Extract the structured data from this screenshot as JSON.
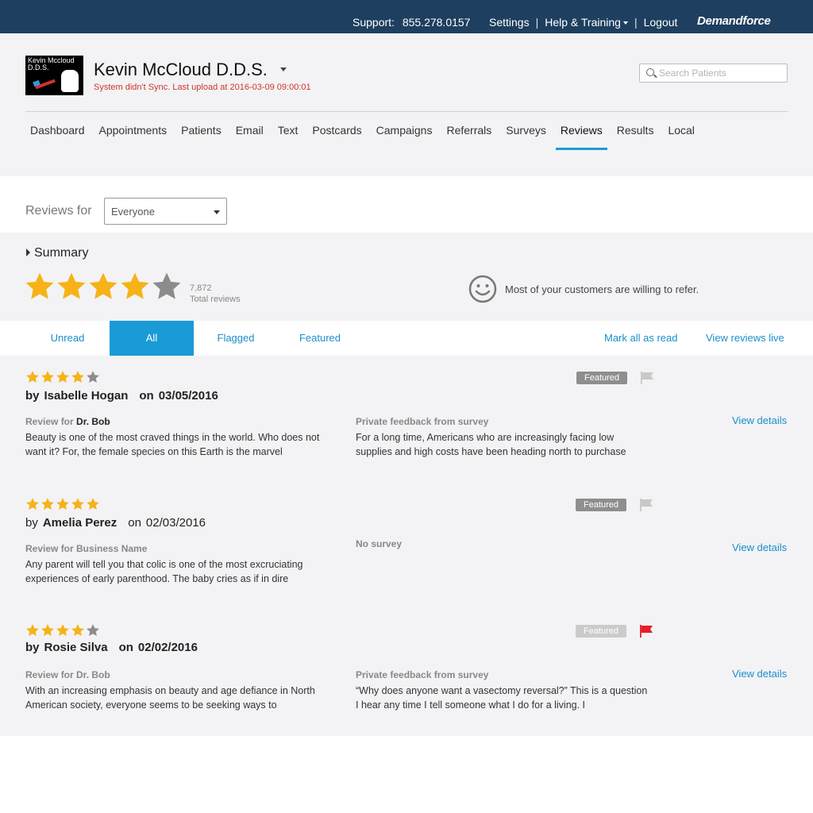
{
  "topbar": {
    "support_label": "Support:",
    "support_phone": "855.278.0157",
    "settings": "Settings",
    "separator": "|",
    "help": "Help & Training",
    "logout": "Logout",
    "brand": "Demandforce"
  },
  "header": {
    "logo_text": "Kevin Mccloud D.D.S.",
    "practice_name": "Kevin McCloud D.D.S.",
    "sync_status": "System didn't Sync. Last upload at 2016-03-09 09:00:01",
    "search_placeholder": "Search Patients"
  },
  "nav": [
    {
      "label": "Dashboard"
    },
    {
      "label": "Appointments"
    },
    {
      "label": "Patients"
    },
    {
      "label": "Email"
    },
    {
      "label": "Text"
    },
    {
      "label": "Postcards"
    },
    {
      "label": "Campaigns"
    },
    {
      "label": "Referrals"
    },
    {
      "label": "Surveys"
    },
    {
      "label": "Reviews",
      "active": true
    },
    {
      "label": "Results"
    },
    {
      "label": "Local"
    }
  ],
  "filter": {
    "label": "Reviews for",
    "selected": "Everyone"
  },
  "summary": {
    "title": "Summary",
    "rating": 4,
    "max_rating": 5,
    "total_count": "7,872",
    "total_label": "Total reviews",
    "refer_text": "Most of your customers are willing to refer."
  },
  "tabs": {
    "unread": "Unread",
    "all": "All",
    "flagged": "Flagged",
    "featured": "Featured",
    "mark_all_read": "Mark all as read",
    "view_live": "View reviews live"
  },
  "colors": {
    "topbar": "#1e3f5f",
    "accent": "#1a9ad6",
    "star_gold": "#f5b318",
    "star_gray": "#8c8c8c",
    "flag_red": "#e41f26"
  },
  "reviews": [
    {
      "rating": 4,
      "by": "by",
      "name": "Isabelle Hogan",
      "on": "on",
      "date": "03/05/2016",
      "bold_meta": true,
      "badge": "Featured",
      "badge_style": "dark",
      "flagged": false,
      "review_for_label": "Review for",
      "review_for_name": "Dr. Bob",
      "review_text": "Beauty is one of the most craved things in the world. Who does not want it? For, the female species on this Earth is the marvel",
      "private_label": "Private feedback from survey",
      "private_text": "For a long time, Americans who are increasingly facing low supplies and high costs have been heading north to purchase",
      "details": "View details"
    },
    {
      "rating": 5,
      "by": "by",
      "name": "Amelia Perez",
      "on": "on",
      "date": "02/03/2016",
      "bold_meta": false,
      "badge": "Featured",
      "badge_style": "dark",
      "flagged": false,
      "review_for_label": "Review for Business Name",
      "review_for_name": "",
      "review_text": "Any parent will tell you that colic is one of the most excruciating experiences of early parenthood. The baby cries as if in dire",
      "private_label": "No survey",
      "private_text": "",
      "details": "View details"
    },
    {
      "rating": 4,
      "by": "by",
      "name": "Rosie Silva",
      "on": "on",
      "date": "02/02/2016",
      "bold_meta": true,
      "badge": "Featured",
      "badge_style": "light",
      "flagged": true,
      "review_for_label": "Review for Dr. Bob",
      "review_for_name": "",
      "review_text": "With an increasing emphasis on beauty and age defiance in North American society, everyone seems to be seeking ways to",
      "private_label": "Private feedback from survey",
      "private_text": "“Why does anyone want a vasectomy reversal?” This is a question I hear any time I tell someone what I do for a living. I",
      "details": "View details"
    }
  ]
}
